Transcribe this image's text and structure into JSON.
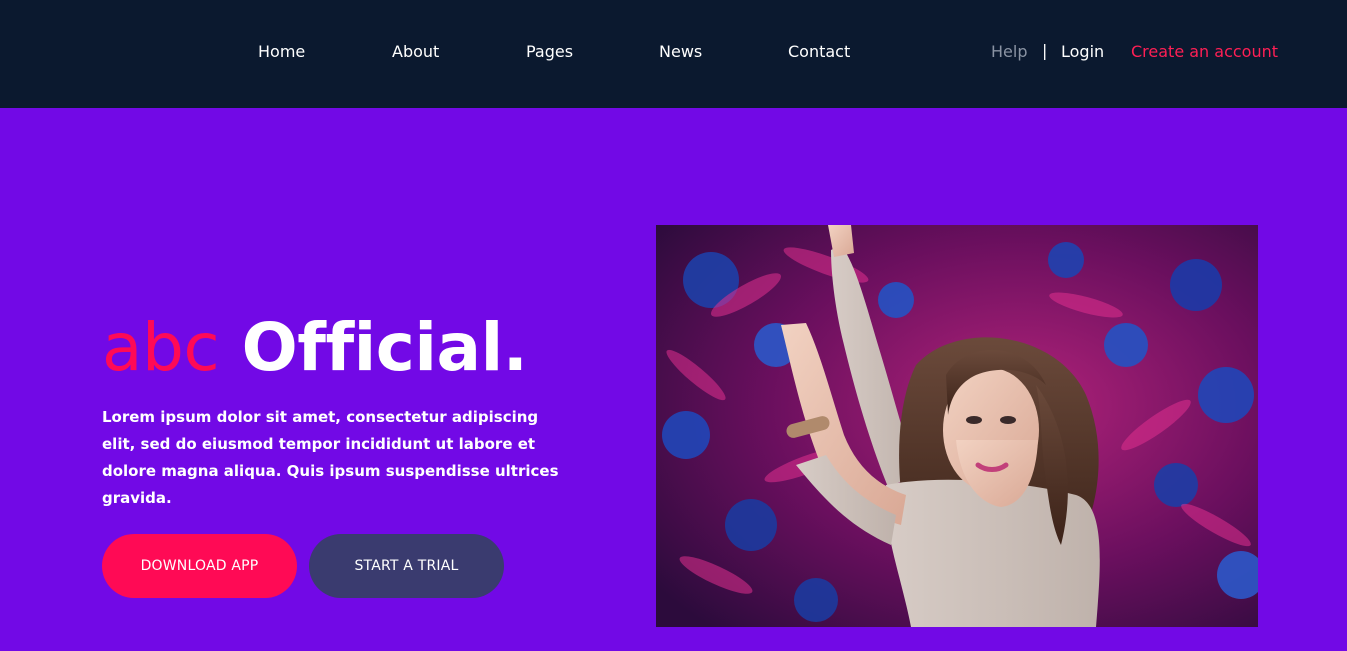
{
  "nav": {
    "links": [
      "Home",
      "About",
      "Pages",
      "News",
      "Contact"
    ],
    "help": "Help",
    "separator": "|",
    "login": "Login",
    "create_account": "Create an account"
  },
  "hero": {
    "title_accent": "abc",
    "title_main": "Official.",
    "body": "Lorem ipsum dolor sit amet, consectetur adipiscing elit, sed do eiusmod tempor incididunt ut labore et dolore magna aliqua. Quis ipsum suspendisse ultrices gravida.",
    "download_label": "DOWNLOAD APP",
    "trial_label": "START A TRIAL"
  },
  "colors": {
    "nav_background": "#0b192f",
    "page_background": "#7209e6",
    "accent": "#ff0a56",
    "secondary_button": "#3a3b6f",
    "muted_text": "#8a93a3"
  }
}
